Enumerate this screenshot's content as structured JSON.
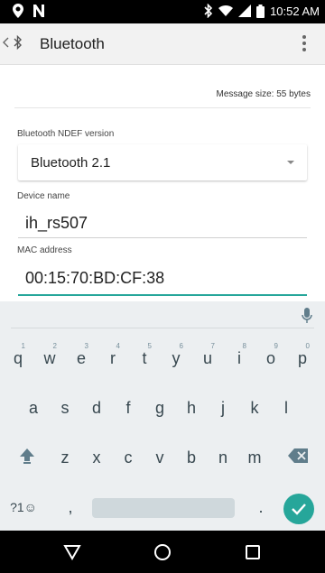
{
  "status_bar": {
    "time": "10:52 AM",
    "icons": [
      "location-pin-icon",
      "n-notification-icon",
      "bluetooth-icon",
      "wifi-icon",
      "signal-icon",
      "battery-icon"
    ]
  },
  "app_bar": {
    "title": "Bluetooth",
    "icons": [
      "back-icon",
      "bluetooth-icon",
      "overflow-menu-icon"
    ]
  },
  "content": {
    "message_size": "Message size: 55 bytes",
    "ndef_version_label": "Bluetooth NDEF version",
    "ndef_version_value": "Bluetooth 2.1",
    "device_name_label": "Device name",
    "device_name_value": "ih_rs507",
    "mac_label": "MAC address",
    "mac_value": "00:15:70:BD:CF:38"
  },
  "keyboard": {
    "row1": [
      "q",
      "w",
      "e",
      "r",
      "t",
      "y",
      "u",
      "i",
      "o",
      "p"
    ],
    "row1_hints": [
      "1",
      "2",
      "3",
      "4",
      "5",
      "6",
      "7",
      "8",
      "9",
      "0"
    ],
    "row2": [
      "a",
      "s",
      "d",
      "f",
      "g",
      "h",
      "j",
      "k",
      "l"
    ],
    "row3": [
      "z",
      "x",
      "c",
      "v",
      "b",
      "n",
      "m"
    ],
    "symbols_key": "?1☺",
    "comma_key": ",",
    "period_key": "."
  },
  "colors": {
    "accent": "#26a69a",
    "status_bar": "#000000",
    "keyboard_bg": "#eceff1"
  }
}
